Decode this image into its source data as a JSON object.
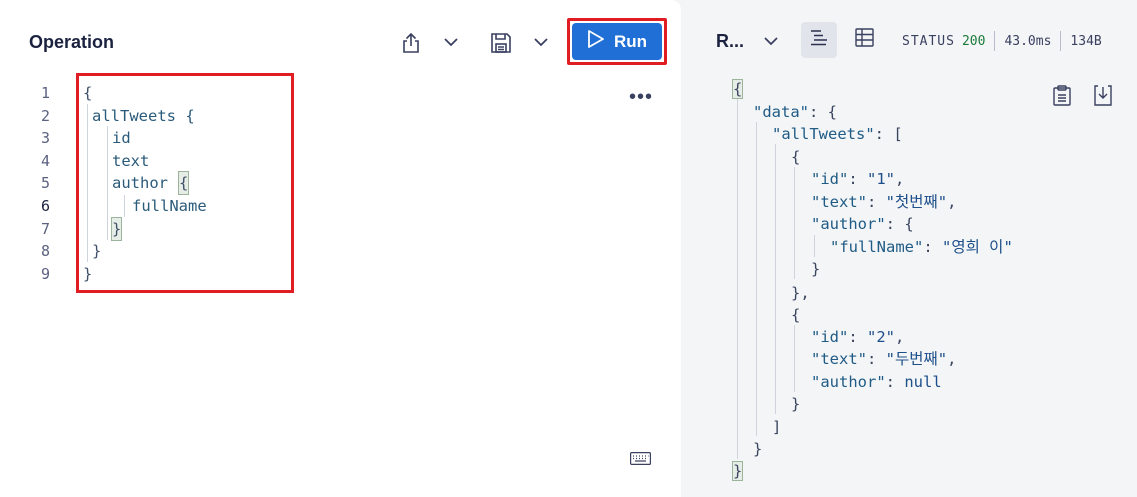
{
  "operation": {
    "title": "Operation",
    "run_label": "Run",
    "line_numbers": [
      "1",
      "2",
      "3",
      "4",
      "5",
      "6",
      "7",
      "8",
      "9"
    ],
    "active_line": "6",
    "code": {
      "l1": "{",
      "l2": "allTweets {",
      "l3": "id",
      "l4": "text",
      "l5_field": "author",
      "l5_brace": "{",
      "l6": "fullName",
      "l7": "}",
      "l8": "}",
      "l9": "}"
    },
    "more_label": "•••"
  },
  "response": {
    "title": "R...",
    "status_label": "STATUS",
    "status_code": "200",
    "time": "43.0ms",
    "size": "134B",
    "json": {
      "open": "{",
      "data_key": "\"data\"",
      "alltweets_key": "\"allTweets\"",
      "id_key": "\"id\"",
      "text_key": "\"text\"",
      "author_key": "\"author\"",
      "fullname_key": "\"fullName\"",
      "item1_id": "\"1\"",
      "item1_text": "\"첫번째\"",
      "item1_fullname": "\"영희 이\"",
      "item2_id": "\"2\"",
      "item2_text": "\"두번째\"",
      "null_value": "null",
      "close": "}"
    }
  },
  "icons": {
    "share": "share-icon",
    "save": "save-icon",
    "chevron": "chevron-down-icon",
    "play": "play-icon",
    "list_view": "list-view-icon",
    "table_view": "table-view-icon",
    "copy": "clipboard-icon",
    "download": "download-icon",
    "keyboard": "keyboard-icon"
  },
  "colors": {
    "run_button": "#1f6fd6",
    "highlight_border": "#e11d24",
    "status_ok": "#1b7a3a"
  }
}
